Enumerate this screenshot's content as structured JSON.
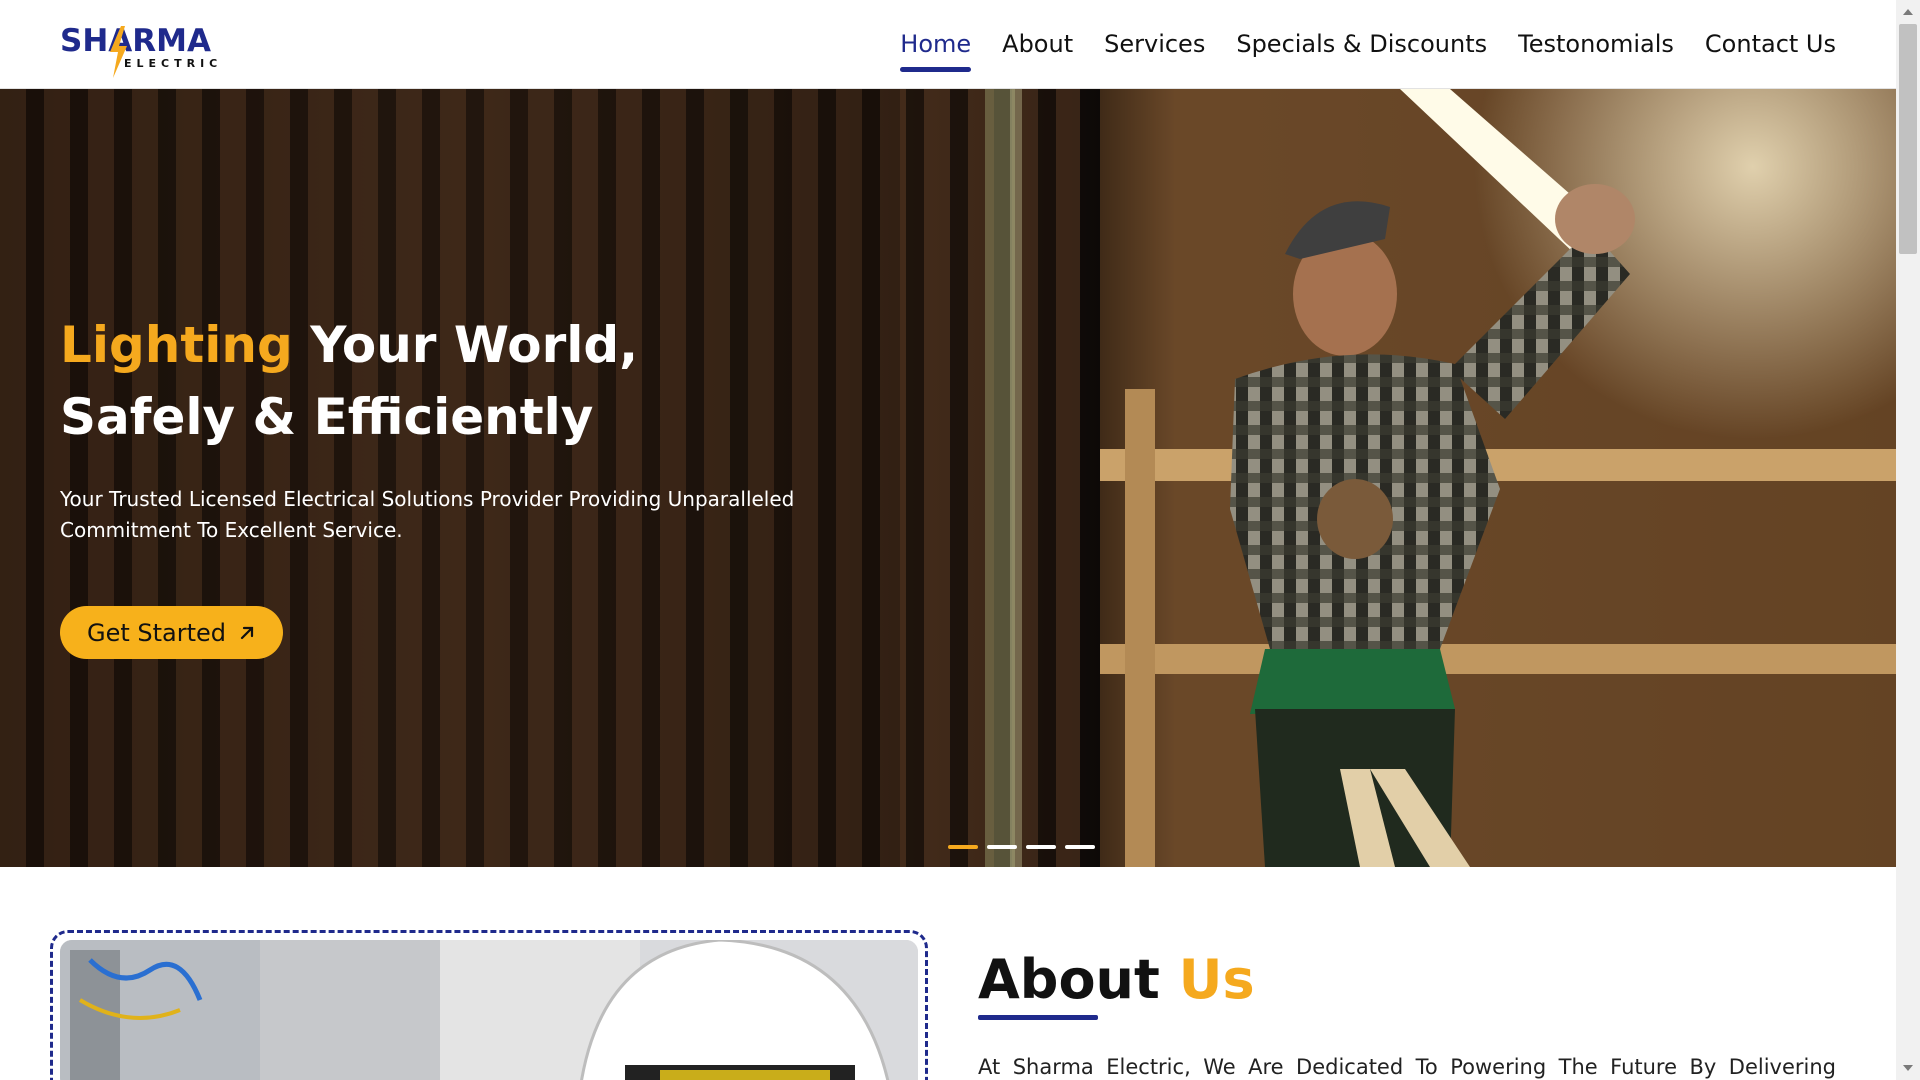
{
  "brand": {
    "name": "SHARMA",
    "sub": "ELECTRIC",
    "colors": {
      "primary": "#1f2a8c",
      "accent": "#f5a91e",
      "button": "#f7b11b"
    }
  },
  "nav": {
    "items": [
      {
        "label": "Home",
        "active": true
      },
      {
        "label": "About"
      },
      {
        "label": "Services"
      },
      {
        "label": "Specials & Discounts"
      },
      {
        "label": "Testonomials"
      },
      {
        "label": "Contact Us"
      }
    ]
  },
  "hero": {
    "title_accent": "Lighting",
    "title_rest": "Your World, Safely & Efficiently",
    "subtitle": "Your Trusted Licensed Electrical Solutions Provider Providing Unparalleled Commitment To Excellent Service.",
    "cta_label": "Get Started",
    "cta_icon": "arrow-up-right-icon",
    "slides": 4,
    "active_slide": 1
  },
  "about": {
    "title_main": "About",
    "title_accent": "Us",
    "text": "At Sharma Electric, We Are Dedicated To Powering The Future By Delivering"
  }
}
